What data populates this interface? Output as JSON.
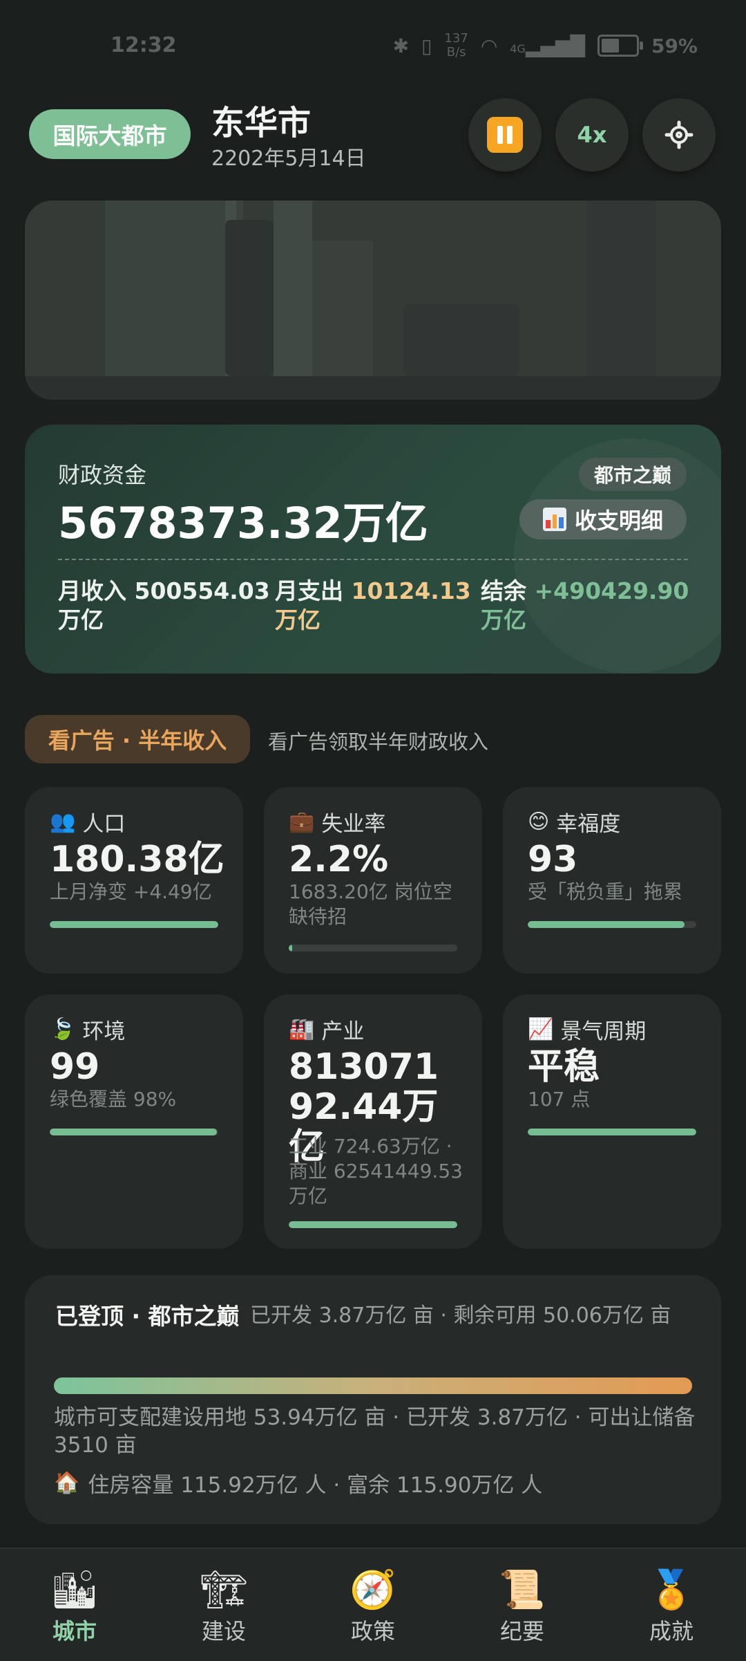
{
  "status_bar": {
    "time": "12:32",
    "net_speed_value": "137",
    "net_speed_unit": "B/s",
    "signal": "4G",
    "battery": "59%",
    "battery_level": 0.59
  },
  "header": {
    "tier_badge": "国际大都市",
    "city_name": "东华市",
    "date": "2202年5月14日",
    "speed": "4x"
  },
  "finance": {
    "label": "财政资金",
    "amount": "5678373.32万亿",
    "peak_badge": "都市之巅",
    "detail_button": "收支明细",
    "monthly_income_label": "月收入",
    "monthly_income_value": "500554.03",
    "monthly_income_unit": "万亿",
    "monthly_expense_label": "月支出",
    "monthly_expense_value": "10124.13",
    "monthly_expense_unit": "万亿",
    "surplus_label": "结余",
    "surplus_value": "+490429.90",
    "surplus_unit": "万亿",
    "colors": {
      "income": "#eef2ef",
      "expense": "#f2c98a",
      "surplus": "#7fbf96"
    }
  },
  "ad": {
    "button": "看广告 · 半年收入",
    "description": "看广告领取半年财政收入"
  },
  "stats": {
    "population": {
      "title": "人口",
      "value": "180.38亿",
      "sub": "上月净变 +4.49亿",
      "level": 1.0
    },
    "unemployment": {
      "title": "失业率",
      "value": "2.2%",
      "sub": "1683.20亿 岗位空缺待招",
      "level": 0.022
    },
    "happiness": {
      "title": "幸福度",
      "value": "93",
      "sub": "受「税负重」拖累",
      "level": 0.93
    },
    "environment": {
      "title": "环境",
      "value": "99",
      "sub": "绿色覆盖 98%",
      "level": 0.99
    },
    "industry": {
      "title": "产业",
      "value": "81307192.44万亿",
      "sub": "工业 724.63万亿 · 商业 62541449.53万亿",
      "level": 1.0
    },
    "business_cycle": {
      "title": "景气周期",
      "value": "平稳",
      "sub": "107 点",
      "level": 1.0
    }
  },
  "land": {
    "title": "已登顶 · 都市之巅",
    "developed": "已开发 3.87万亿 亩 · 剩余可用 50.06万亿 亩",
    "info": "城市可支配建设用地 53.94万亿 亩 · 已开发 3.87万亿 · 可出让储备 3510 亩",
    "housing": "住房容量 115.92万亿 人 · 富余 115.90万亿 人"
  },
  "nav": {
    "items": [
      {
        "label": "城市",
        "icon": "city-icon"
      },
      {
        "label": "建设",
        "icon": "construction-crane-icon"
      },
      {
        "label": "政策",
        "icon": "compass-icon"
      },
      {
        "label": "纪要",
        "icon": "scroll-icon"
      },
      {
        "label": "成就",
        "icon": "medal-icon"
      }
    ],
    "active_index": 0
  }
}
